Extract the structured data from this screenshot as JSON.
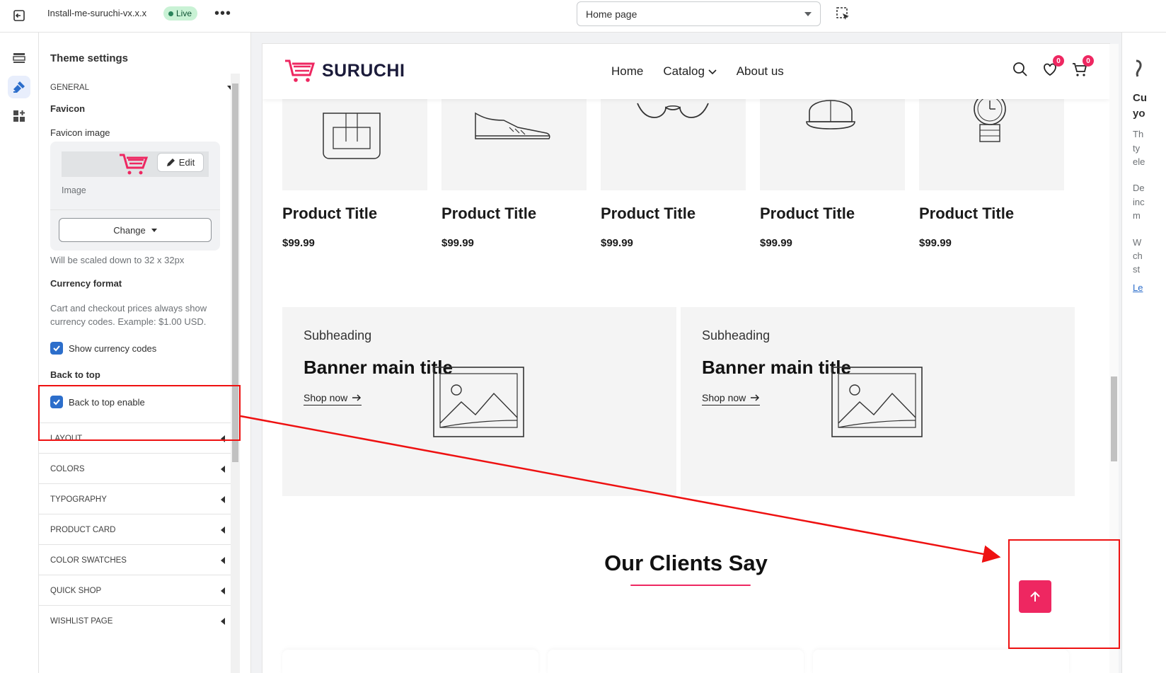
{
  "topbar": {
    "theme_name": "Install-me-suruchi-vx.x.x",
    "live_label": "Live",
    "more_label": "•••",
    "page_select": "Home page"
  },
  "settings": {
    "title": "Theme settings",
    "general": {
      "heading": "GENERAL",
      "favicon_label": "Favicon",
      "favicon_image_label": "Favicon image",
      "edit_label": "Edit",
      "image_label": "Image",
      "change_label": "Change",
      "scale_hint": "Will be scaled down to 32 x 32px",
      "currency_format_label": "Currency format",
      "currency_hint": "Cart and checkout prices always show currency codes. Example: $1.00 USD.",
      "show_currency_label": "Show currency codes",
      "show_currency_checked": true,
      "back_to_top_label": "Back to top",
      "back_to_top_enable_label": "Back to top enable",
      "back_to_top_checked": true
    },
    "sections": [
      "LAYOUT",
      "COLORS",
      "TYPOGRAPHY",
      "PRODUCT CARD",
      "COLOR SWATCHES",
      "QUICK SHOP",
      "WISHLIST PAGE"
    ]
  },
  "store": {
    "logo": "SURUCHI",
    "nav": {
      "home": "Home",
      "catalog": "Catalog",
      "about": "About us"
    },
    "wishlist_count": "0",
    "cart_count": "0",
    "products": [
      {
        "title": "Product Title",
        "price": "$99.99",
        "icon": "backpack-icon"
      },
      {
        "title": "Product Title",
        "price": "$99.99",
        "icon": "sneaker-icon"
      },
      {
        "title": "Product Title",
        "price": "$99.99",
        "icon": "glasses-icon"
      },
      {
        "title": "Product Title",
        "price": "$99.99",
        "icon": "cap-icon"
      },
      {
        "title": "Product Title",
        "price": "$99.99",
        "icon": "watch-icon"
      }
    ],
    "banners": [
      {
        "subheading": "Subheading",
        "title": "Banner main title",
        "link": "Shop now"
      },
      {
        "subheading": "Subheading",
        "title": "Banner main title",
        "link": "Shop now"
      }
    ],
    "clients_title": "Our Clients Say"
  },
  "right_panel": {
    "lines": [
      "Cu",
      "yo",
      "Th",
      "ty",
      "ele",
      "De",
      "inc",
      "m",
      "W",
      "ch",
      "st",
      "Le"
    ]
  },
  "colors": {
    "accent": "#ee2761",
    "annotation": "#e11111",
    "checkbox": "#2c6ecb"
  }
}
